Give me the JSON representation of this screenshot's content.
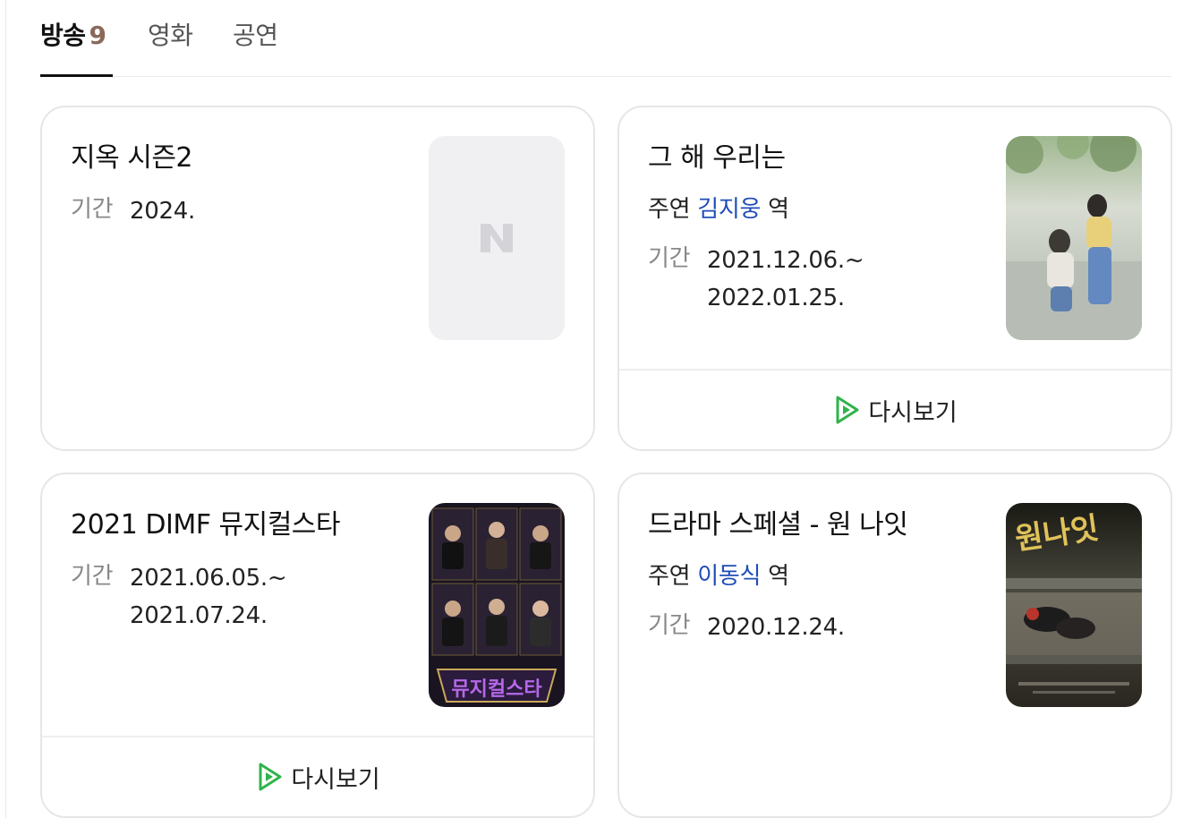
{
  "tabs": [
    {
      "label": "방송",
      "count": "9",
      "active": true
    },
    {
      "label": "영화",
      "active": false
    },
    {
      "label": "공연",
      "active": false
    }
  ],
  "cards": [
    {
      "title": "지옥 시즌2",
      "period_label": "기간",
      "period": [
        "2024."
      ],
      "poster_icon": "naver-n-placeholder-icon"
    },
    {
      "title": "그 해 우리는",
      "cast_prefix": "주연",
      "cast_name": "김지웅",
      "cast_suffix": "역",
      "period_label": "기간",
      "period": [
        "2021.12.06.~",
        "2022.01.25."
      ],
      "replay_label": "다시보기"
    },
    {
      "title": "2021 DIMF 뮤지컬스타",
      "period_label": "기간",
      "period": [
        "2021.06.05.~",
        "2021.07.24."
      ],
      "poster_text": "뮤지컬스타",
      "replay_label": "다시보기"
    },
    {
      "title": "드라마 스페셜 - 원 나잇",
      "cast_prefix": "주연",
      "cast_name": "이동식",
      "cast_suffix": "역",
      "period_label": "기간",
      "period": [
        "2020.12.24."
      ],
      "poster_text": "원나잇"
    }
  ],
  "colors": {
    "cast_link": "#1f4db8",
    "replay_icon": "#2fb34a",
    "tab_count": "#8a6a5a"
  }
}
